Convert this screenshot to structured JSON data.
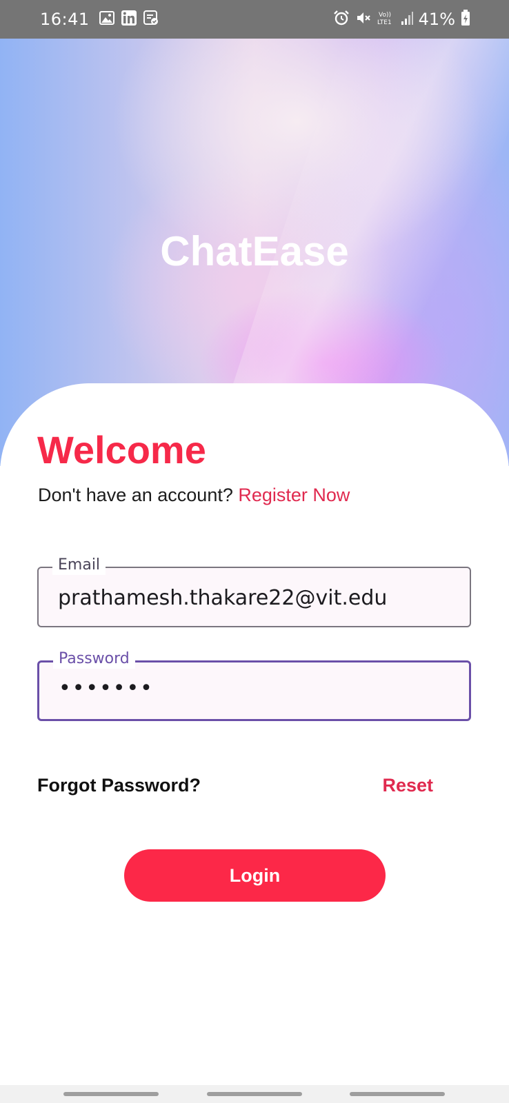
{
  "status_bar": {
    "time": "16:41",
    "battery_text": "41%",
    "left_icons": [
      "gallery-icon",
      "linkedin-icon",
      "notes-icon"
    ],
    "right_icons": [
      "alarm-icon",
      "mute-icon",
      "volte-icon",
      "signal-icon",
      "battery-icon"
    ],
    "volte_text": "Vo)) LTE1"
  },
  "hero": {
    "app_title": "ChatEase"
  },
  "login": {
    "welcome": "Welcome",
    "no_account_text": "Don't have an account?",
    "register_link": "Register Now",
    "email_label": "Email",
    "email_value": "prathamesh.thakare22@vit.edu",
    "password_label": "Password",
    "password_value": "•••••••",
    "forgot_text": "Forgot Password?",
    "reset_link": "Reset",
    "login_button": "Login"
  },
  "colors": {
    "accent": "#fc2848",
    "field_focus": "#6a4fa8",
    "status_bar": "#757575"
  }
}
